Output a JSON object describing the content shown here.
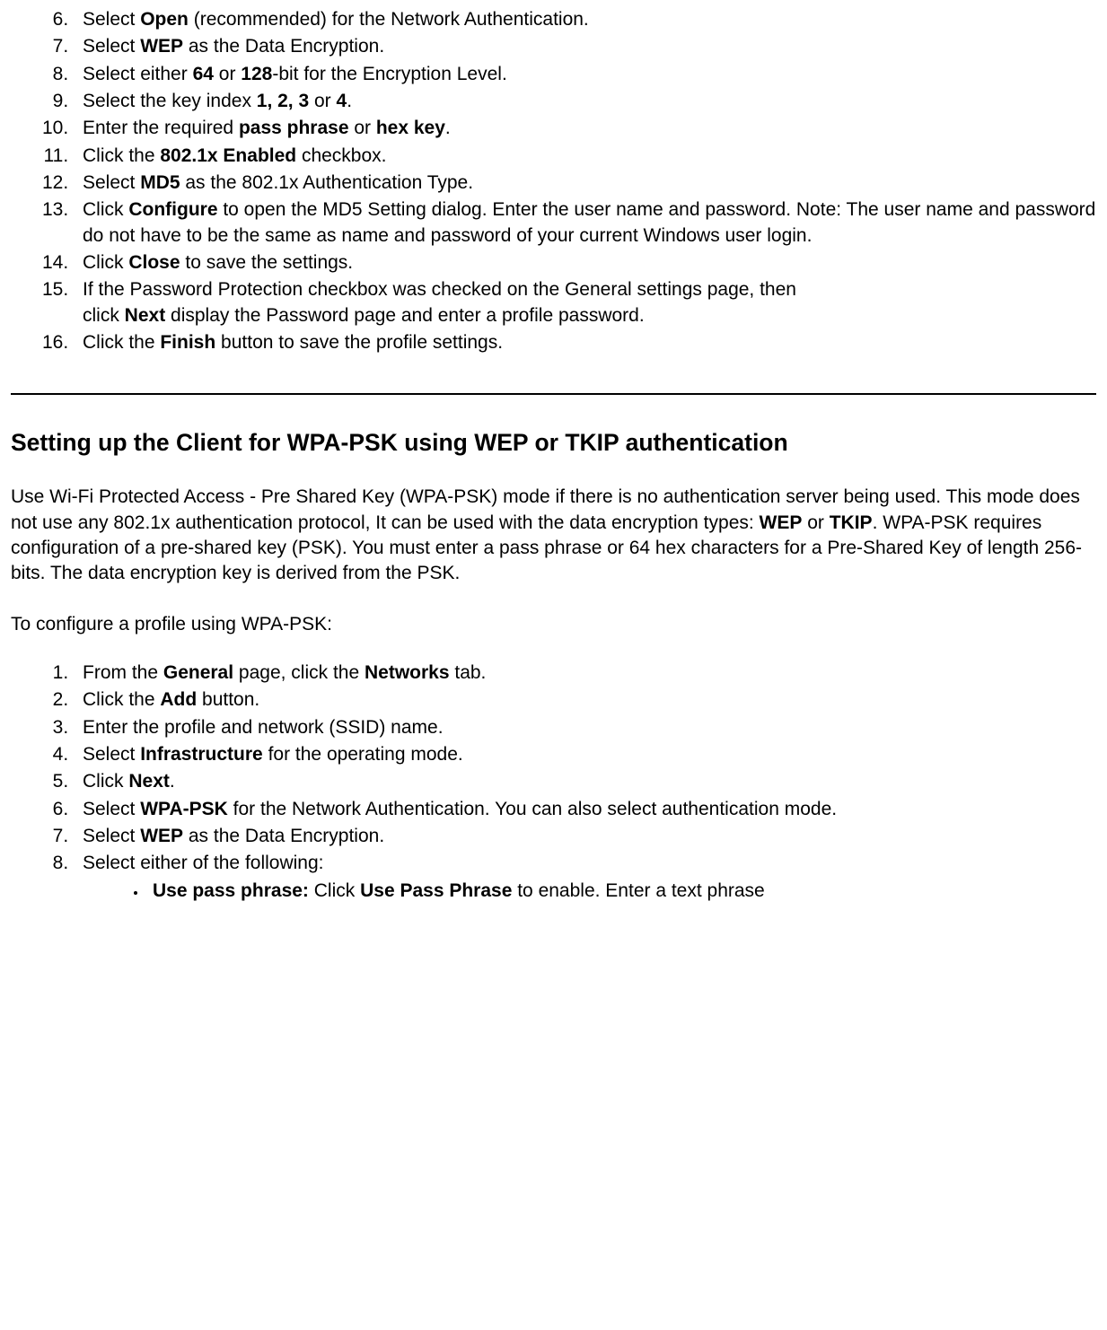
{
  "list1": {
    "start": 6,
    "items": [
      {
        "pre": "Select ",
        "b1": "Open",
        "post": " (recommended) for the Network Authentication."
      },
      {
        "pre": "Select ",
        "b1": "WEP",
        "post": " as the Data Encryption."
      },
      {
        "pre": "Select either ",
        "b1": "64",
        "mid": " or ",
        "b2": "128",
        "post": "-bit for the Encryption Level."
      },
      {
        "pre": "Select the key index ",
        "b1": "1, 2, 3",
        "mid": " or ",
        "b2": "4",
        "post": "."
      },
      {
        "pre": "Enter the required ",
        "b1": "pass phrase",
        "mid": " or ",
        "b2": "hex key",
        "post": "."
      },
      {
        "pre": "Click the ",
        "b1": "802.1x Enabled",
        "post": " checkbox."
      },
      {
        "pre": "Select ",
        "b1": "MD5",
        "post": " as the 802.1x Authentication Type."
      },
      {
        "pre": "Click ",
        "b1": "Configure",
        "post": " to open the MD5 Setting dialog. Enter the user name and password. Note: The user name and password do not have to be the same as name and password of your current Windows user login."
      },
      {
        "pre": "Click ",
        "b1": "Close",
        "post": " to save the settings."
      },
      {
        "pre": "If the Password Protection checkbox was checked on the General settings page, then",
        "br": true,
        "pre2": "click ",
        "b1": "Next",
        "post": " display the Password page and enter a profile password."
      },
      {
        "pre": "Click the ",
        "b1": "Finish",
        "post": " button to save the profile settings."
      }
    ]
  },
  "heading": "Setting up the Client for WPA-PSK using WEP or TKIP authentication",
  "para1": {
    "seg1": "Use Wi-Fi Protected Access - Pre Shared Key (WPA-PSK) mode if there is no authentication server being used. This mode does not use any 802.1x authentication protocol, It can be used with the data encryption types: ",
    "b1": "WEP",
    "seg2": " or ",
    "b2": "TKIP",
    "seg3": ". WPA-PSK requires configuration of a pre-shared key (PSK). You must enter a pass phrase or 64 hex characters for a Pre-Shared Key of length 256-bits. The data encryption key is derived from the PSK."
  },
  "para2": "To configure a profile using WPA-PSK:",
  "list2": {
    "items": [
      {
        "pre": "From the ",
        "b1": "General",
        "mid": " page, click the ",
        "b2": "Networks",
        "post": " tab."
      },
      {
        "pre": "Click the ",
        "b1": "Add",
        "post": " button."
      },
      {
        "plain": "Enter the profile and network (SSID) name."
      },
      {
        "pre": "Select ",
        "b1": "Infrastructure",
        "post": " for the operating mode."
      },
      {
        "pre": "Click ",
        "b1": "Next",
        "post": "."
      },
      {
        "pre": "Select ",
        "b1": "WPA-PSK",
        "post": " for the Network Authentication. You can also select authentication mode."
      },
      {
        "pre": "Select ",
        "b1": "WEP",
        "post": " as the Data Encryption."
      },
      {
        "plain": "Select either of the following:",
        "sub": [
          {
            "b1": "Use pass phrase:",
            "mid": " Click ",
            "b2": "Use Pass Phrase",
            "post": " to enable. Enter a text phrase"
          }
        ]
      }
    ]
  }
}
